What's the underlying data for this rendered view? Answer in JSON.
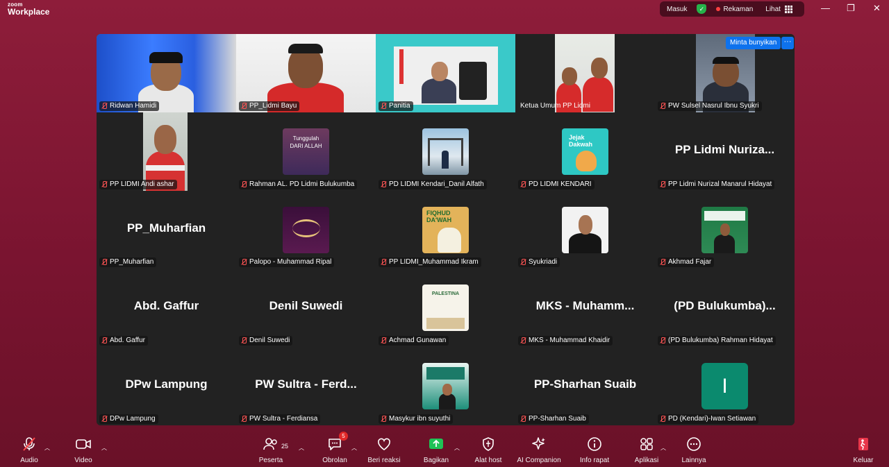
{
  "app": {
    "logo_line1": "zoom",
    "logo_line2": "Workplace"
  },
  "titlebar": {
    "masuk": "Masuk",
    "recording_label": "Rekaman",
    "view_label": "Lihat",
    "minimize_symbol": "—",
    "restore_symbol": "❐",
    "close_symbol": "✕"
  },
  "overlay": {
    "request_audio": "Minta bunyikan",
    "more": "···"
  },
  "participants": [
    {
      "label": "Ridwan Hamidi",
      "kind": "video",
      "active": true
    },
    {
      "label": "PP_Lidmi Bayu",
      "kind": "video"
    },
    {
      "label": "Panitia",
      "kind": "video"
    },
    {
      "label": "Ketua Umum PP Lidmi",
      "kind": "video"
    },
    {
      "label": "PW Sulsel Nasrul Ibnu Syukri",
      "kind": "video"
    },
    {
      "label": "PP LIDMI Andi ashar",
      "kind": "video-small"
    },
    {
      "label": "Rahman AL. PD Lidmi Bulukumba",
      "kind": "pic",
      "pic_text": "Tunggulah\nDARI ALLAH"
    },
    {
      "label": "PD LIDMI Kendari_Danil Alfath",
      "kind": "pic"
    },
    {
      "label": "PD LIDMI KENDARI",
      "kind": "pic",
      "pic_text": "Jejak\nDakwah"
    },
    {
      "label": "PP Lidmi Nurizal Manarul Hidayat",
      "kind": "name",
      "display_name": "PP Lidmi Nuriza..."
    },
    {
      "label": "PP_Muharfian",
      "kind": "name",
      "display_name": "PP_Muharfian"
    },
    {
      "label": "Palopo - Muhammad Ripal",
      "kind": "pic"
    },
    {
      "label": "PP LIDMI_Muhammad Ikram",
      "kind": "pic",
      "pic_text": "FIQHUD\nDA'WAH"
    },
    {
      "label": "Syukriadi",
      "kind": "pic"
    },
    {
      "label": "Akhmad Fajar",
      "kind": "pic"
    },
    {
      "label": "Abd. Gaffur",
      "kind": "name",
      "display_name": "Abd. Gaffur"
    },
    {
      "label": "Denil Suwedi",
      "kind": "name",
      "display_name": "Denil Suwedi"
    },
    {
      "label": "Achmad Gunawan",
      "kind": "pic",
      "pic_text": "PALESTINA"
    },
    {
      "label": "MKS - Muhammad Khaidir",
      "kind": "name",
      "display_name": "MKS - Muhamm..."
    },
    {
      "label": "(PD Bulukumba) Rahman Hidayat",
      "kind": "name",
      "display_name": "(PD Bulukumba)..."
    },
    {
      "label": "DPw Lampung",
      "kind": "name",
      "display_name": "DPw Lampung"
    },
    {
      "label": "PW Sultra - Ferdiansa",
      "kind": "name",
      "display_name": "PW Sultra - Ferd..."
    },
    {
      "label": "Masykur ibn suyuthi",
      "kind": "pic"
    },
    {
      "label": "PP-Sharhan Suaib",
      "kind": "name",
      "display_name": "PP-Sharhan Suaib"
    },
    {
      "label": "PD (Kendari)-Iwan Setiawan",
      "kind": "initial",
      "initial": "I"
    }
  ],
  "toolbar": {
    "audio": "Audio",
    "video": "Video",
    "participants": "Peserta",
    "participants_count": "25",
    "chat": "Obrolan",
    "chat_badge": "5",
    "reactions": "Beri reaksi",
    "share": "Bagikan",
    "host_tools": "Alat host",
    "ai_companion": "AI Companion",
    "meeting_info": "Info rapat",
    "apps": "Aplikasi",
    "more": "Lainnya",
    "leave": "Keluar"
  },
  "colors": {
    "background": "#7a1430",
    "active_speaker": "#2fd46a",
    "share_green": "#1fc256",
    "leave_red": "#e8364a",
    "badge_red": "#e02828",
    "accent_blue": "#0e72ed"
  }
}
